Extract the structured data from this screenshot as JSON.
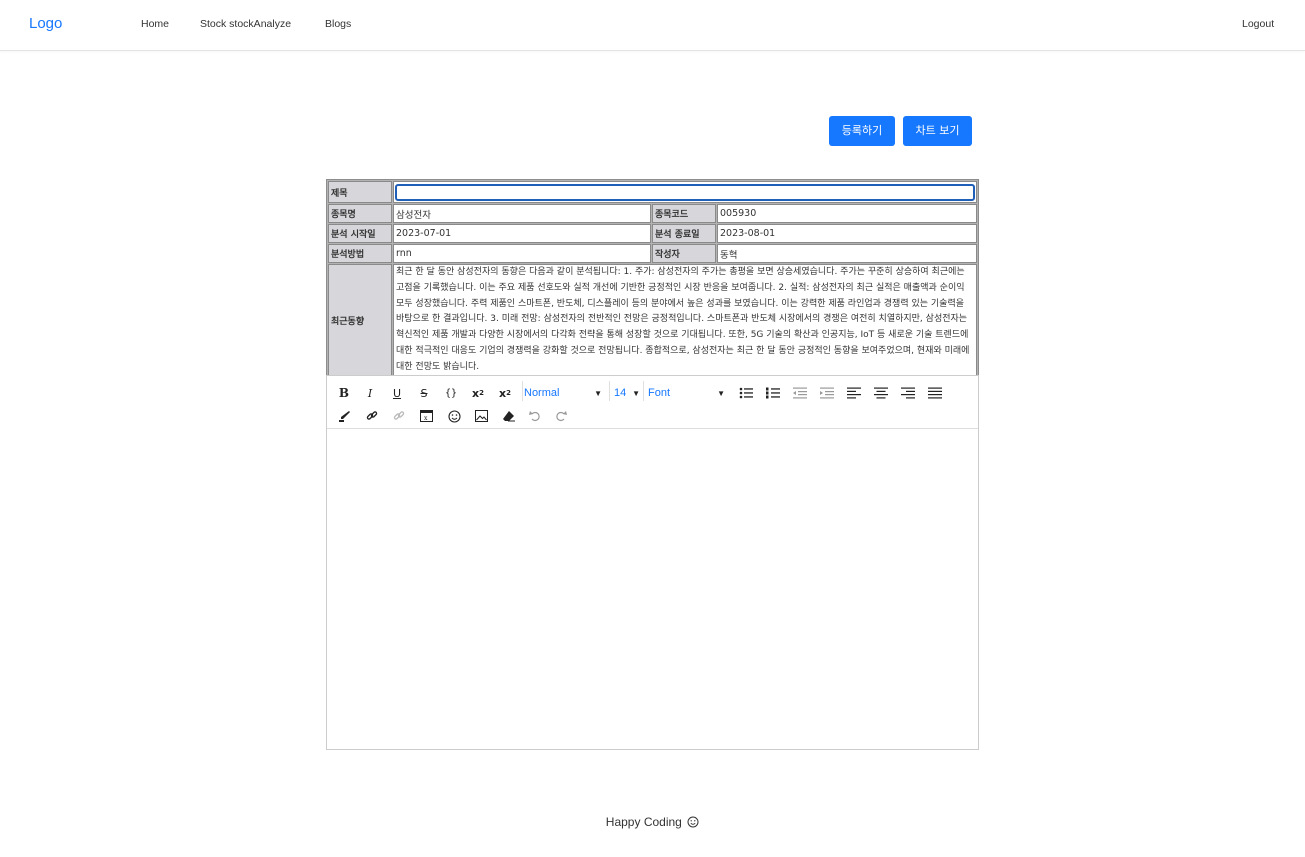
{
  "header": {
    "logo": "Logo",
    "nav": [
      "Home",
      "Stock stockAnalyze",
      "Blogs"
    ],
    "logout": "Logout"
  },
  "actions": {
    "register": "등록하기",
    "chart": "차트 보기"
  },
  "form": {
    "title_label": "제목",
    "title_value": "",
    "stock_name_label": "종목명",
    "stock_name": "삼성전자",
    "stock_code_label": "종목코드",
    "stock_code": "005930",
    "start_label": "분석 시작일",
    "start_date": "2023-07-01",
    "end_label": "분석 종료일",
    "end_date": "2023-08-01",
    "method_label": "분석방법",
    "method": "rnn",
    "author_label": "작성자",
    "author": "동혁",
    "trend_label": "최근동향",
    "trend": "최근 한 달 동안 삼성전자의 동향은 다음과 같이 분석됩니다: 1. 주가: 삼성전자의 주가는 총평을 보면 상승세였습니다. 주가는 꾸준히 상승하여 최근에는 고점을 기록했습니다. 이는 주요 제품 선호도와 실적 개선에 기반한 긍정적인 시장 반응을 보여줍니다. 2. 실적: 삼성전자의 최근 실적은 매출액과 순이익 모두 성장했습니다. 주력 제품인 스마트폰, 반도체, 디스플레이 등의 분야에서 높은 성과를 보였습니다. 이는 강력한 제품 라인업과 경쟁력 있는 기술력을 바탕으로 한 결과입니다. 3. 미래 전망: 삼성전자의 전반적인 전망은 긍정적입니다. 스마트폰과 반도체 시장에서의 경쟁은 여전히 치열하지만, 삼성전자는 혁신적인 제품 개발과 다양한 시장에서의 다각화 전략을 통해 성장할 것으로 기대됩니다. 또한, 5G 기술의 확산과 인공지능, IoT 등 새로운 기술 트렌드에 대한 적극적인 대응도 기업의 경쟁력을 강화할 것으로 전망됩니다. 종합적으로, 삼성전자는 최근 한 달 동안 긍정적인 동향을 보여주었으며, 현재와 미래에 대한 전망도 밝습니다."
  },
  "editor": {
    "heading_select": "Normal",
    "size_select": "14",
    "font_select": "Font",
    "icons": [
      "bold-icon",
      "italic-icon",
      "underline-icon",
      "strike-icon",
      "code-icon",
      "superscript-icon",
      "subscript-icon",
      "bullet-list-icon",
      "ordered-list-icon",
      "outdent-icon",
      "indent-icon",
      "align-left-icon",
      "align-center-icon",
      "align-right-icon",
      "align-justify-icon",
      "color-icon",
      "link-icon",
      "unlink-icon",
      "formula-icon",
      "emoji-icon",
      "image-icon",
      "clear-format-icon",
      "undo-icon",
      "redo-icon"
    ]
  },
  "footer": {
    "text": "Happy Coding"
  },
  "colors": {
    "accent": "#1677ff",
    "label_bg": "#d6d6db",
    "focus_border": "#1f5fb8"
  }
}
